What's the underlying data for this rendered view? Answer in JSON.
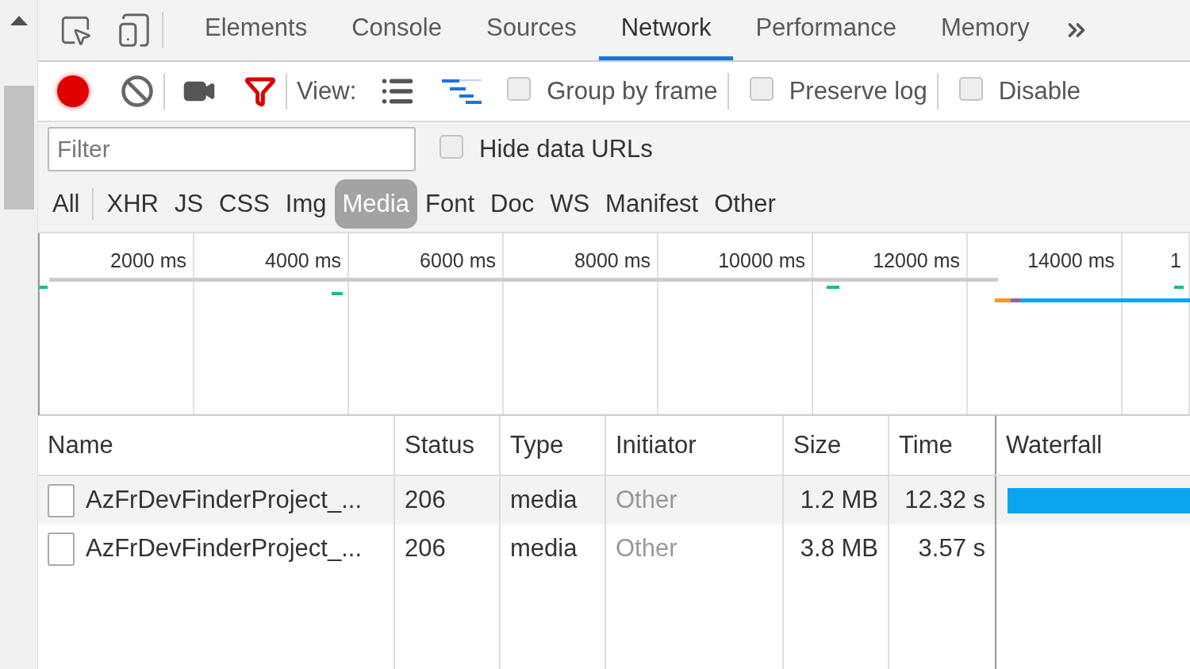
{
  "panel_tabs": [
    {
      "label": "Elements",
      "selected": false
    },
    {
      "label": "Console",
      "selected": false
    },
    {
      "label": "Sources",
      "selected": false
    },
    {
      "label": "Network",
      "selected": true
    },
    {
      "label": "Performance",
      "selected": false
    },
    {
      "label": "Memory",
      "selected": false
    }
  ],
  "toolbar": {
    "recording": true,
    "filter_active": true,
    "view_label": "View:",
    "view_options": [
      {
        "kind": "list",
        "selected": false
      },
      {
        "kind": "waterfall",
        "selected": true
      }
    ],
    "checkboxes": [
      {
        "label": "Group by frame",
        "checked": false
      },
      {
        "label": "Preserve log",
        "checked": false
      },
      {
        "label": "Disable",
        "checked": false
      }
    ]
  },
  "filter": {
    "placeholder": "Filter",
    "hide_data_urls": {
      "label": "Hide data URLs",
      "checked": false
    }
  },
  "type_filters": [
    {
      "label": "All",
      "selected": false
    },
    {
      "label": "XHR",
      "selected": false
    },
    {
      "label": "JS",
      "selected": false
    },
    {
      "label": "CSS",
      "selected": false
    },
    {
      "label": "Img",
      "selected": false
    },
    {
      "label": "Media",
      "selected": true
    },
    {
      "label": "Font",
      "selected": false
    },
    {
      "label": "Doc",
      "selected": false
    },
    {
      "label": "WS",
      "selected": false
    },
    {
      "label": "Manifest",
      "selected": false
    },
    {
      "label": "Other",
      "selected": false
    }
  ],
  "timeline": {
    "ticks": [
      "2000 ms",
      "4000 ms",
      "6000 ms",
      "8000 ms",
      "10000 ms",
      "12000 ms",
      "14000 ms",
      "1"
    ]
  },
  "table": {
    "columns": [
      "Name",
      "Status",
      "Type",
      "Initiator",
      "Size",
      "Time",
      "Waterfall"
    ],
    "rows": [
      {
        "name": "AzFrDevFinderProject_...",
        "status": "206",
        "type": "media",
        "initiator": "Other",
        "size": "1.2 MB",
        "time": "12.32 s",
        "selected": true,
        "waterfall_bar": true
      },
      {
        "name": "AzFrDevFinderProject_...",
        "status": "206",
        "type": "media",
        "initiator": "Other",
        "size": "3.8 MB",
        "time": "3.57 s",
        "selected": false,
        "waterfall_bar": false
      }
    ]
  }
}
